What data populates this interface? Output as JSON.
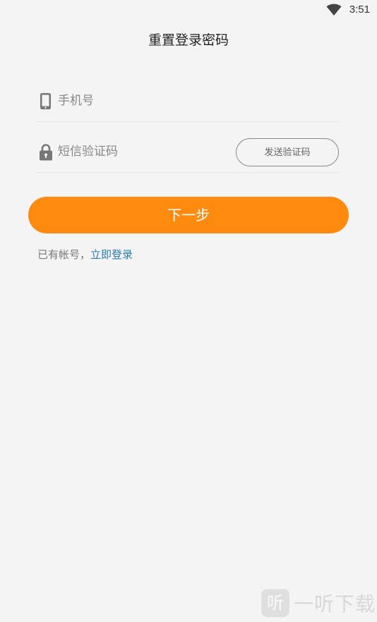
{
  "status_bar": {
    "time": "3:51",
    "wifi_icon": "wifi-icon"
  },
  "header": {
    "title": "重置登录密码"
  },
  "form": {
    "phone": {
      "icon": "smartphone-icon",
      "placeholder": "手机号",
      "value": ""
    },
    "sms_code": {
      "icon": "lock-icon",
      "placeholder": "短信验证码",
      "value": "",
      "send_button_label": "发送验证码"
    },
    "next_button_label": "下一步",
    "login_prompt": "已有帐号，",
    "login_link_label": "立即登录"
  },
  "watermark": {
    "logo_text": "听",
    "text": "一听下载"
  },
  "colors": {
    "background": "#f4f4f4",
    "accent": "#ff8a10",
    "link": "#2a79b8"
  }
}
